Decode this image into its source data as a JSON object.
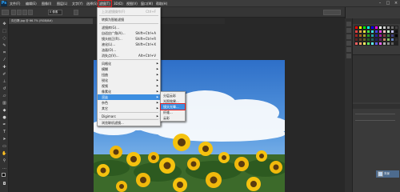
{
  "app": {
    "logo_text": "Ps"
  },
  "menubar": {
    "items": [
      "文件(F)",
      "编辑(E)",
      "图像(I)",
      "图层(L)",
      "文字(Y)",
      "选择(S)",
      "滤镜(T)",
      "3D(D)",
      "视图(V)",
      "窗口(W)",
      "帮助(H)"
    ]
  },
  "window_controls": {
    "minimize": "–",
    "restore": "□",
    "close": "×"
  },
  "options_bar": {
    "feather_value": "0 像素"
  },
  "document": {
    "tab_label": "向日葵.jpg @ 66.7% (RGB/8#)"
  },
  "filter_menu": {
    "last_filter": {
      "label": "上次滤镜操作(F)",
      "shortcut": "Ctrl+F"
    },
    "smart": "转换为智能滤镜",
    "gallery": {
      "label": "滤镜库(G)...",
      "shortcut": ""
    },
    "adaptive": {
      "label": "自适应广角(A)...",
      "shortcut": "Shift+Ctrl+A"
    },
    "camera_raw": {
      "label": "镜头校正(R)...",
      "shortcut": "Shift+Ctrl+R"
    },
    "liquify": {
      "label": "液化(L)...",
      "shortcut": "Shift+Ctrl+X"
    },
    "oil": {
      "label": "油画(O)...",
      "shortcut": ""
    },
    "vanish": {
      "label": "消失点(V)...",
      "shortcut": "Alt+Ctrl+V"
    },
    "categories": [
      "风格化",
      "模糊",
      "扭曲",
      "锐化",
      "视频",
      "像素化",
      "渲染",
      "杂色",
      "其它"
    ],
    "rendered_index": 6,
    "digimarc": "Digimarc",
    "browse": "浏览联机滤镜..."
  },
  "render_submenu": {
    "items": [
      "分层云彩",
      "光照效果...",
      "镜头光晕...",
      "纤维...",
      "云彩"
    ],
    "highlighted_index": 2
  },
  "layers": {
    "item_label": "背景"
  },
  "colors": {
    "accent": "#3d8ee0",
    "highlight_outline": "#e02020"
  }
}
